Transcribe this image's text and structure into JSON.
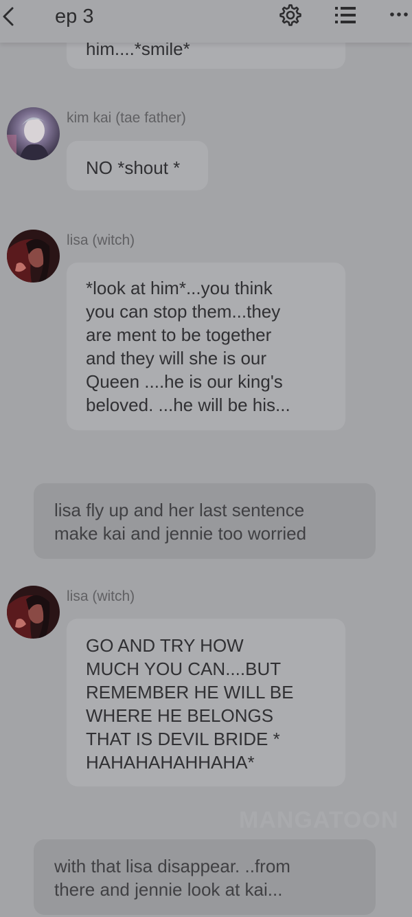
{
  "header": {
    "title": "ep 3",
    "back_icon": "chevron-left-icon",
    "settings_icon": "gear-icon",
    "list_icon": "list-icon",
    "more_icon": "more-dots-icon"
  },
  "messages": [
    {
      "type": "character",
      "text": "him....*smile*"
    },
    {
      "type": "character",
      "speaker": "kim kai (tae father)",
      "text": "NO *shout *"
    },
    {
      "type": "character",
      "speaker": "lisa (witch)",
      "text": "*look at him*...you think\nyou can stop them...they\nare ment to be together\nand they will she is our\nQueen ....he is our king's\nbeloved. ...he will be his..."
    },
    {
      "type": "narration",
      "text": "lisa fly up and her last sentence\nmake kai and jennie too worried"
    },
    {
      "type": "character",
      "speaker": "lisa (witch)",
      "text": "GO AND TRY HOW\nMUCH YOU CAN....BUT\nREMEMBER HE WILL BE\nWHERE HE BELONGS\nTHAT IS DEVIL BRIDE *\nHAHAHAHAHHAHA*"
    },
    {
      "type": "narration",
      "text": "with that lisa disappear. ..from\nthere and jennie look at kai..."
    }
  ],
  "watermark": "MANGATOON"
}
